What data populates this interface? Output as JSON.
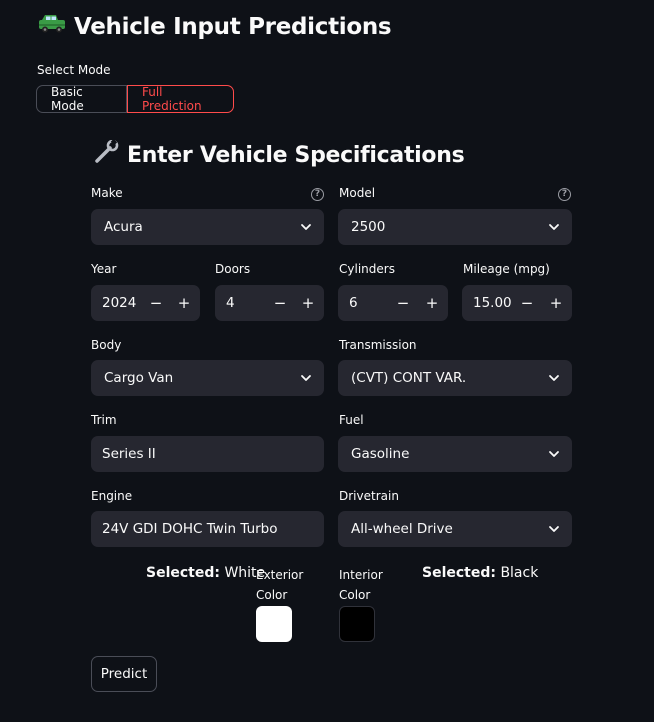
{
  "app": {
    "title": "Vehicle Input Predictions",
    "title_icon": "🚙"
  },
  "mode": {
    "label": "Select Mode",
    "options": [
      "Basic Mode",
      "Full Prediction"
    ],
    "selected": "Full Prediction"
  },
  "section": {
    "title": "Enter Vehicle Specifications",
    "icon": "🔧"
  },
  "fields": {
    "make": {
      "label": "Make",
      "value": "Acura",
      "type": "select"
    },
    "model": {
      "label": "Model",
      "value": "2500",
      "type": "select"
    },
    "year": {
      "label": "Year",
      "value": "2024",
      "type": "number"
    },
    "doors": {
      "label": "Doors",
      "value": "4",
      "type": "number"
    },
    "cylinders": {
      "label": "Cylinders",
      "value": "6",
      "type": "number"
    },
    "mileage": {
      "label": "Mileage (mpg)",
      "value": "15.00",
      "type": "number"
    },
    "body": {
      "label": "Body",
      "value": "Cargo Van",
      "type": "select"
    },
    "transmission": {
      "label": "Transmission",
      "value": "(CVT) CONT VAR.",
      "type": "select"
    },
    "trim": {
      "label": "Trim",
      "value": "Series II",
      "type": "text"
    },
    "fuel": {
      "label": "Fuel",
      "value": "Gasoline",
      "type": "select"
    },
    "engine": {
      "label": "Engine",
      "value": "24V GDI DOHC Twin Turbo",
      "type": "text"
    },
    "drivetrain": {
      "label": "Drivetrain",
      "value": "All-wheel Drive",
      "type": "select"
    }
  },
  "colors": {
    "selected_prefix": "Selected:",
    "exterior": {
      "selected_value": "White",
      "label_line1": "Exterior",
      "label_line2": "Color",
      "swatch": "#ffffff"
    },
    "interior": {
      "selected_value": "Black",
      "label_line1": "Interior",
      "label_line2": "Color",
      "swatch": "#000000"
    }
  },
  "actions": {
    "predict_label": "Predict"
  },
  "theme": {
    "background": "#0e1117",
    "input_bg": "#262730",
    "accent": "#ff4b4b"
  }
}
